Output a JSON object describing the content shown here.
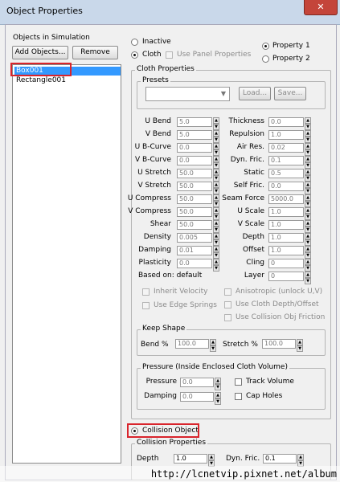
{
  "window": {
    "title": "Object Properties",
    "close_glyph": "✕"
  },
  "objects": {
    "label": "Objects in Simulation",
    "add_button": "Add Objects...",
    "remove_button": "Remove",
    "items": [
      "Box001",
      "Rectangle001"
    ],
    "selected": "Box001"
  },
  "mode": {
    "inactive": "Inactive",
    "cloth": "Cloth",
    "use_panel": "Use Panel Properties",
    "selected": "Cloth"
  },
  "property_set": {
    "p1": "Property 1",
    "p2": "Property 2",
    "selected": "Property 1"
  },
  "cloth_properties": {
    "title": "Cloth Properties",
    "presets_title": "Presets",
    "load_button": "Load...",
    "save_button": "Save...",
    "left_params": [
      {
        "label": "U Bend",
        "value": "5.0"
      },
      {
        "label": "V Bend",
        "value": "5.0"
      },
      {
        "label": "U B-Curve",
        "value": "0.0"
      },
      {
        "label": "V B-Curve",
        "value": "0.0"
      },
      {
        "label": "U Stretch",
        "value": "50.0"
      },
      {
        "label": "V Stretch",
        "value": "50.0"
      },
      {
        "label": "U Compress",
        "value": "50.0"
      },
      {
        "label": "V Compress",
        "value": "50.0"
      },
      {
        "label": "Shear",
        "value": "50.0"
      },
      {
        "label": "Density",
        "value": "0.005"
      },
      {
        "label": "Damping",
        "value": "0.01"
      },
      {
        "label": "Plasticity",
        "value": "0.0"
      }
    ],
    "right_params": [
      {
        "label": "Thickness",
        "value": "0.0"
      },
      {
        "label": "Repulsion",
        "value": "1.0"
      },
      {
        "label": "Air Res.",
        "value": "0.02"
      },
      {
        "label": "Dyn. Fric.",
        "value": "0.1"
      },
      {
        "label": "Static",
        "value": "0.5"
      },
      {
        "label": "Self Fric.",
        "value": "0.0"
      },
      {
        "label": "Seam Force",
        "value": "5000.0"
      },
      {
        "label": "U Scale",
        "value": "1.0"
      },
      {
        "label": "V Scale",
        "value": "1.0"
      },
      {
        "label": "Depth",
        "value": "1.0"
      },
      {
        "label": "Offset",
        "value": "1.0"
      },
      {
        "label": "Cling",
        "value": "0"
      }
    ],
    "based_on": "Based on: default",
    "layer_label": "Layer",
    "layer_value": "0",
    "inherit_velocity": "Inherit Velocity",
    "use_edge_springs": "Use Edge Springs",
    "anisotropic": "Anisotropic (unlock U,V)",
    "use_cloth_depth": "Use Cloth Depth/Offset",
    "use_collision_friction": "Use Collision Obj Friction"
  },
  "keep_shape": {
    "title": "Keep Shape",
    "bend_label": "Bend %",
    "bend_value": "100.0",
    "stretch_label": "Stretch %",
    "stretch_value": "100.0"
  },
  "pressure": {
    "title": "Pressure (Inside Enclosed Cloth Volume)",
    "pressure_label": "Pressure",
    "pressure_value": "0.0",
    "damping_label": "Damping",
    "damping_value": "0.0",
    "track_volume": "Track Volume",
    "cap_holes": "Cap Holes"
  },
  "collision": {
    "option": "Collision Object",
    "title": "Collision Properties",
    "depth_label": "Depth",
    "depth_value": "1.0",
    "dyn_fric_label": "Dyn. Fric.",
    "dyn_fric_value": "0.1"
  },
  "watermark": "http://lcnetvip.pixnet.net/album",
  "colors": {
    "highlight": "#d9242c",
    "selection": "#3399ff"
  }
}
